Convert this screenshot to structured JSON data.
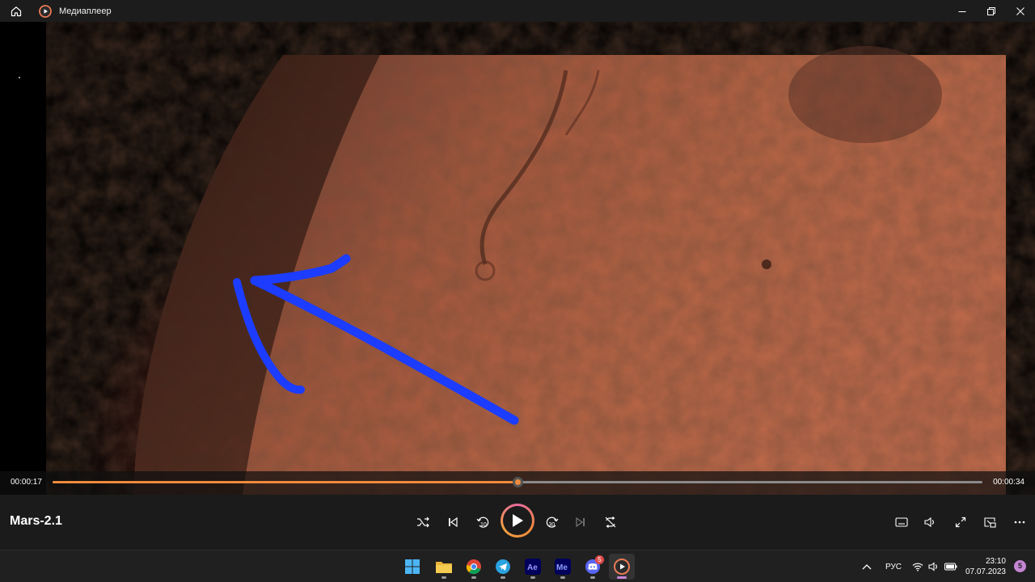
{
  "window": {
    "title": "Медиаплеер"
  },
  "icons": {
    "home": "home-icon",
    "app": "media-player-icon",
    "minimize": "minimize-icon",
    "maximize": "maximize-icon",
    "close": "close-icon",
    "shuffle": "shuffle-icon",
    "previous": "previous-icon",
    "rewind": "rewind-10-icon",
    "play": "play-icon",
    "forward": "forward-30-icon",
    "next": "next-icon",
    "repeat": "repeat-icon",
    "subtitles": "subtitles-icon",
    "volume": "volume-icon",
    "fullscreen": "fullscreen-icon",
    "miniplayer": "miniplayer-icon",
    "more": "more-icon"
  },
  "player": {
    "media_title": "Mars-2.1",
    "current_time": "00:00:17",
    "total_time": "00:00:34",
    "progress_fraction": 0.5,
    "rewind_seconds": "10",
    "forward_seconds": "30",
    "accent_color": "#f08a3c"
  },
  "taskbar": {
    "apps": [
      {
        "name": "start",
        "icon": "windows-start-icon",
        "badge": ""
      },
      {
        "name": "explorer",
        "icon": "file-explorer-icon",
        "badge": ""
      },
      {
        "name": "chrome",
        "icon": "chrome-icon",
        "badge": ""
      },
      {
        "name": "telegram",
        "icon": "telegram-icon",
        "badge": ""
      },
      {
        "name": "after-effects",
        "icon": "after-effects-icon",
        "label": "Ae",
        "badge": ""
      },
      {
        "name": "media-encoder",
        "icon": "media-encoder-icon",
        "label": "Me",
        "badge": ""
      },
      {
        "name": "discord",
        "icon": "discord-icon",
        "badge": "5"
      },
      {
        "name": "media-player",
        "icon": "media-player-icon",
        "badge": ""
      }
    ],
    "language": "РУС",
    "time": "23:10",
    "date": "07.07.2023",
    "notifications": "5"
  }
}
